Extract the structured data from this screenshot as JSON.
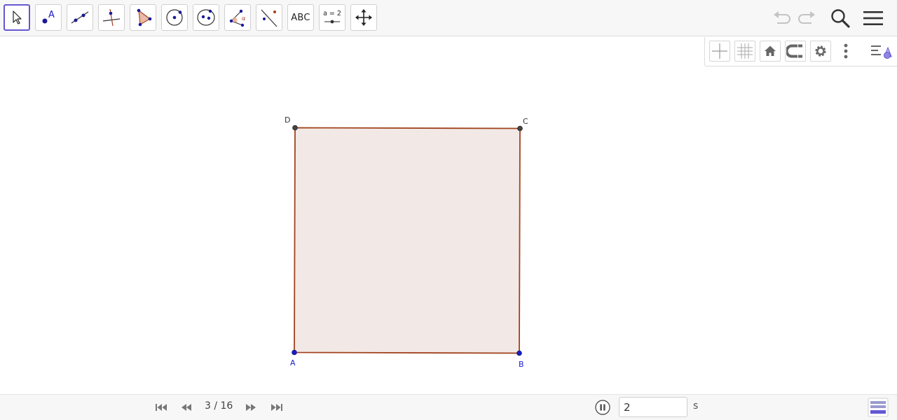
{
  "toolbar": {
    "tools": [
      {
        "id": "move",
        "icon": "cursor-arrow-icon",
        "selected": true
      },
      {
        "id": "point",
        "icon": "point-icon",
        "label": "A"
      },
      {
        "id": "line",
        "icon": "line-through-points-icon"
      },
      {
        "id": "perpendicular",
        "icon": "perpendicular-line-icon"
      },
      {
        "id": "polygon",
        "icon": "polygon-icon"
      },
      {
        "id": "circle",
        "icon": "circle-center-point-icon"
      },
      {
        "id": "conic",
        "icon": "ellipse-icon"
      },
      {
        "id": "angle",
        "icon": "angle-icon",
        "label": "α"
      },
      {
        "id": "reflect",
        "icon": "reflect-about-line-icon"
      },
      {
        "id": "text",
        "icon": "text-icon",
        "label": "ABC"
      },
      {
        "id": "slider",
        "icon": "slider-icon",
        "label": "a = 2"
      },
      {
        "id": "move-view",
        "icon": "move-graphics-view-icon"
      }
    ],
    "right": [
      "undo-icon",
      "redo-icon",
      "search-icon",
      "menu-icon"
    ]
  },
  "stylebar": {
    "buttons": [
      "axes-icon",
      "grid-icon",
      "home-icon",
      "point-capturing-icon",
      "settings-icon",
      "more-vert-icon",
      "view-menu-icon"
    ]
  },
  "square": {
    "fill": "#f2e9e6",
    "stroke": "#a0421c",
    "points": [
      {
        "name": "A",
        "color": "#1a1acc"
      },
      {
        "name": "B",
        "color": "#1a1acc"
      },
      {
        "name": "C",
        "color": "#333333"
      },
      {
        "name": "D",
        "color": "#333333"
      }
    ]
  },
  "player": {
    "page_indicator": "3 / 16",
    "speed_value": "2",
    "speed_unit": "s",
    "state": "playing"
  },
  "colors": {
    "accent": "#6557d2",
    "point_blue": "#1a1acc",
    "toolbar_bg": "#f7f7f7"
  }
}
